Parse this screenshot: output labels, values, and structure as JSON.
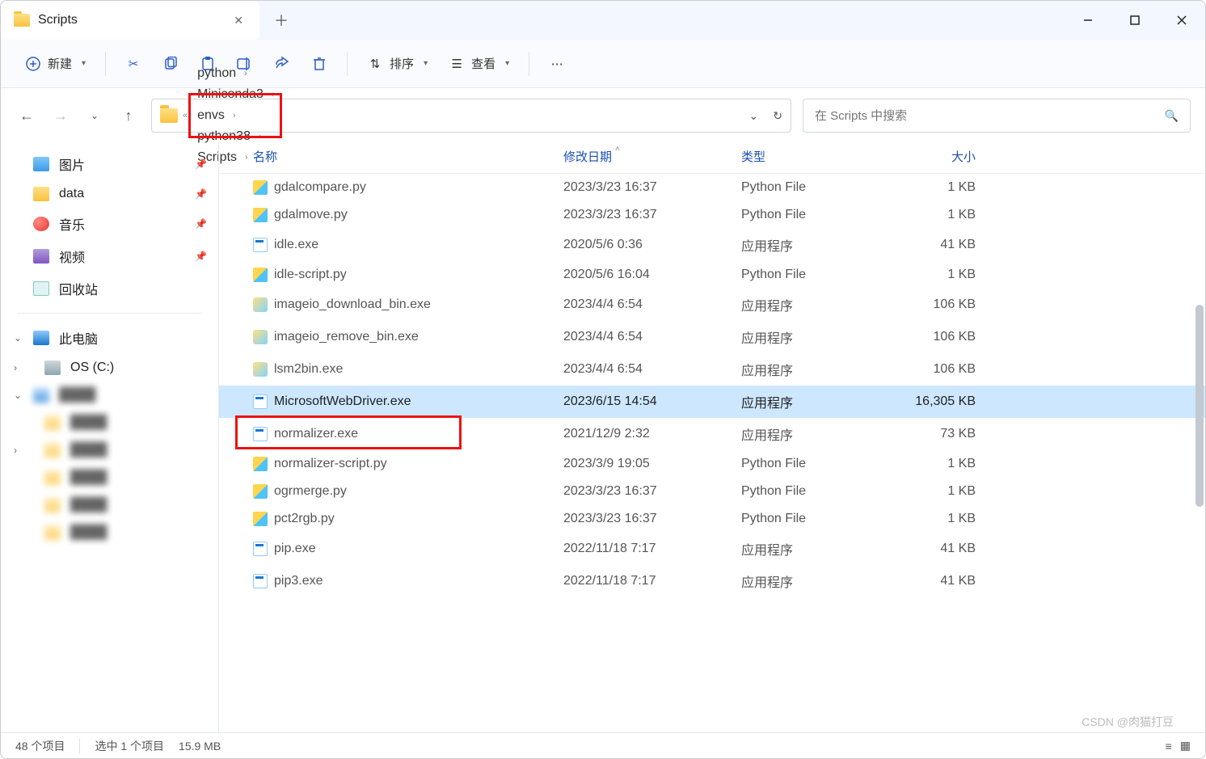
{
  "tab": {
    "title": "Scripts"
  },
  "toolbar": {
    "new_label": "新建",
    "sort_label": "排序",
    "view_label": "查看"
  },
  "breadcrumb": {
    "items": [
      "python",
      "Miniconda3",
      "envs",
      "python38",
      "Scripts"
    ],
    "highlight_index": 4,
    "prefix": "«"
  },
  "search": {
    "placeholder": "在 Scripts 中搜索"
  },
  "sidebar": {
    "quick": [
      {
        "label": "图片",
        "icon": "ico-img",
        "pinned": true
      },
      {
        "label": "data",
        "icon": "ico-data",
        "pinned": true
      },
      {
        "label": "音乐",
        "icon": "ico-music",
        "pinned": true
      },
      {
        "label": "视频",
        "icon": "ico-video",
        "pinned": true
      },
      {
        "label": "回收站",
        "icon": "ico-trash",
        "pinned": false
      }
    ],
    "thispc_label": "此电脑",
    "drive_label": "OS (C:)"
  },
  "columns": {
    "name": "名称",
    "date": "修改日期",
    "type": "类型",
    "size": "大小"
  },
  "files": [
    {
      "name": "gdalcompare.py",
      "date": "2023/3/23 16:37",
      "type": "Python File",
      "size": "1 KB",
      "icon": "ico-py"
    },
    {
      "name": "gdalmove.py",
      "date": "2023/3/23 16:37",
      "type": "Python File",
      "size": "1 KB",
      "icon": "ico-py"
    },
    {
      "name": "idle.exe",
      "date": "2020/5/6 0:36",
      "type": "应用程序",
      "size": "41 KB",
      "icon": "ico-exe"
    },
    {
      "name": "idle-script.py",
      "date": "2020/5/6 16:04",
      "type": "Python File",
      "size": "1 KB",
      "icon": "ico-py"
    },
    {
      "name": "imageio_download_bin.exe",
      "date": "2023/4/4 6:54",
      "type": "应用程序",
      "size": "106 KB",
      "icon": "ico-pyexe"
    },
    {
      "name": "imageio_remove_bin.exe",
      "date": "2023/4/4 6:54",
      "type": "应用程序",
      "size": "106 KB",
      "icon": "ico-pyexe"
    },
    {
      "name": "lsm2bin.exe",
      "date": "2023/4/4 6:54",
      "type": "应用程序",
      "size": "106 KB",
      "icon": "ico-pyexe"
    },
    {
      "name": "MicrosoftWebDriver.exe",
      "date": "2023/6/15 14:54",
      "type": "应用程序",
      "size": "16,305 KB",
      "icon": "ico-exe",
      "selected": true,
      "highlight": true
    },
    {
      "name": "normalizer.exe",
      "date": "2021/12/9 2:32",
      "type": "应用程序",
      "size": "73 KB",
      "icon": "ico-exe"
    },
    {
      "name": "normalizer-script.py",
      "date": "2023/3/9 19:05",
      "type": "Python File",
      "size": "1 KB",
      "icon": "ico-py"
    },
    {
      "name": "ogrmerge.py",
      "date": "2023/3/23 16:37",
      "type": "Python File",
      "size": "1 KB",
      "icon": "ico-py"
    },
    {
      "name": "pct2rgb.py",
      "date": "2023/3/23 16:37",
      "type": "Python File",
      "size": "1 KB",
      "icon": "ico-py"
    },
    {
      "name": "pip.exe",
      "date": "2022/11/18 7:17",
      "type": "应用程序",
      "size": "41 KB",
      "icon": "ico-exe"
    },
    {
      "name": "pip3.exe",
      "date": "2022/11/18 7:17",
      "type": "应用程序",
      "size": "41 KB",
      "icon": "ico-exe"
    }
  ],
  "status": {
    "count": "48 个项目",
    "selection": "选中 1 个项目",
    "size": "15.9 MB"
  },
  "watermark": "CSDN @肉猫打豆"
}
